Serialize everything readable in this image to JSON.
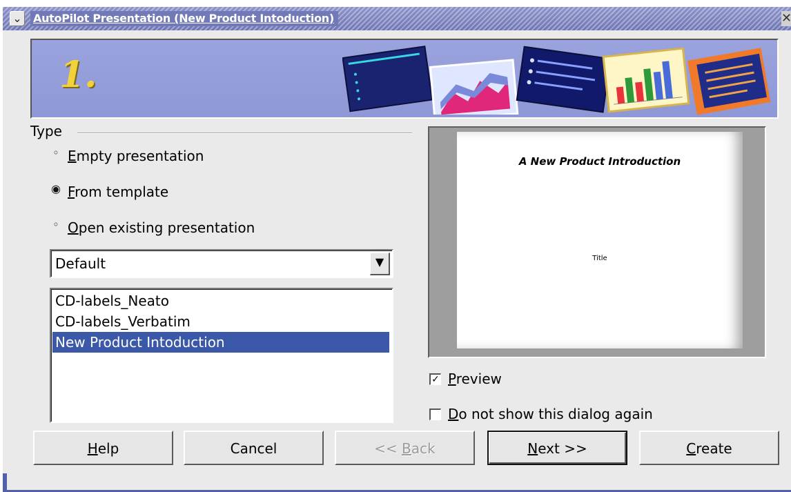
{
  "window": {
    "title": "AutoPilot Presentation (New Product Intoduction)",
    "menu_icon": "chevron-down-icon",
    "close_icon": "close-icon"
  },
  "banner": {
    "step": "1."
  },
  "type_group": {
    "label": "Type",
    "options": [
      {
        "pre": "",
        "mnemonic": "E",
        "post": "mpty presentation",
        "selected": false
      },
      {
        "pre": "",
        "mnemonic": "F",
        "post": "rom template",
        "selected": true
      },
      {
        "pre": "",
        "mnemonic": "O",
        "post": "pen existing presentation",
        "selected": false
      }
    ]
  },
  "category_select": {
    "value": "Default"
  },
  "template_list": {
    "items": [
      "CD-labels_Neato",
      "CD-labels_Verbatim",
      "New Product Intoduction"
    ],
    "selected_index": 2
  },
  "preview": {
    "slide_title": "A New Product Introduction",
    "slide_subtitle": "Title"
  },
  "checkboxes": {
    "preview": {
      "mnemonic": "P",
      "post": "review",
      "checked": true
    },
    "dont_show": {
      "mnemonic": "D",
      "post": "o not show this dialog again",
      "checked": false
    }
  },
  "buttons": {
    "help": {
      "pre": "",
      "mnemonic": "H",
      "post": "elp"
    },
    "cancel": {
      "label": "Cancel"
    },
    "back": {
      "pre": "<< ",
      "mnemonic": "B",
      "post": "ack",
      "enabled": false
    },
    "next": {
      "pre": "",
      "mnemonic": "N",
      "post": "ext >>"
    },
    "create": {
      "pre": "",
      "mnemonic": "C",
      "post": "reate"
    }
  },
  "colors": {
    "titlebar": "#7179b6",
    "banner": "#949dd9",
    "selection": "#3c58a8",
    "dialog_bg": "#eaeaea"
  }
}
